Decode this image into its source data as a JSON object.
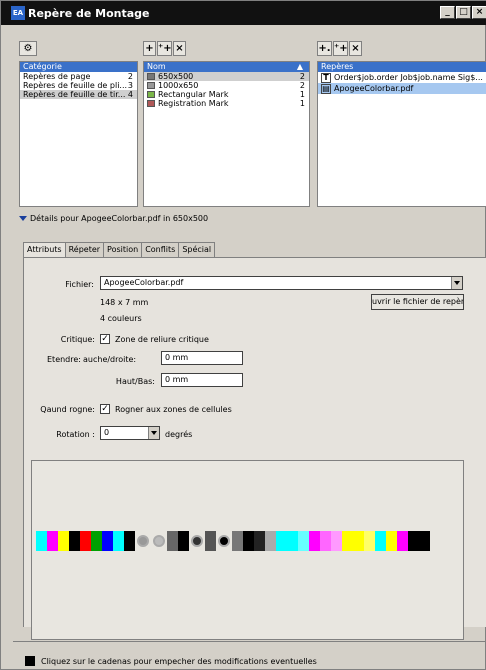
{
  "window": {
    "title": "Repère de Montage",
    "app_icon": "EA"
  },
  "categories": {
    "header": "Catégorie",
    "items": [
      {
        "label": "Repères de page",
        "count": "2"
      },
      {
        "label": "Repères de feuille de pli...",
        "count": "3"
      },
      {
        "label": "Repères de feuille de tir...",
        "count": "4"
      }
    ]
  },
  "names": {
    "header": "Nom",
    "items": [
      {
        "label": "650x500",
        "count": "2",
        "swatch": "#777777"
      },
      {
        "label": "1000x650",
        "count": "2",
        "swatch": "#999999"
      },
      {
        "label": "Rectangular Mark",
        "count": "1",
        "swatch": "#7ab648"
      },
      {
        "label": "Registration Mark",
        "count": "1",
        "swatch": "#b05858"
      }
    ]
  },
  "marks": {
    "header": "Repères",
    "items": [
      {
        "label": "Order$job.order Job$job.name Sig$...",
        "icon": "text-icon"
      },
      {
        "label": "ApogeeColorbar.pdf",
        "icon": "pdf-icon"
      }
    ]
  },
  "details_label": "Détails pour ApogeeColorbar.pdf in 650x500",
  "tabs": [
    "Attributs",
    "Répeter",
    "Position",
    "Conflits",
    "Spécial"
  ],
  "form": {
    "fichier_label": "Fichier:",
    "fichier_value": "ApogeeColorbar.pdf",
    "size": "148 x 7 mm",
    "colors": "4 couleurs",
    "open_button": "uvrir le fichier de repère",
    "critique_label": "Critique:",
    "critique_check": "Zone de reliure critique",
    "etendre_label": "Etendre:",
    "gauche_label": "auche/droite:",
    "gauche_value": "0 mm",
    "haut_label": "Haut/Bas:",
    "haut_value": "0 mm",
    "rogne_label": "Qaund rogne:",
    "rogne_check": "Rogner aux zones de cellules",
    "rotation_label": "Rotation :",
    "rotation_value": "0",
    "rotation_unit": "degrés"
  },
  "footer": "Cliquez sur le cadenas pour empecher des modifications eventuelles",
  "colorbar": [
    "#00ffff",
    "#ff00ff",
    "#ffff00",
    "#000000",
    "#ff0000",
    "#00a000",
    "#0000ff",
    "#00ffff",
    "#000000",
    "#999999",
    "#bbbbbb",
    "#666666",
    "#000000",
    "#333333",
    "#555555",
    "#000000",
    "#777777",
    "#000000",
    "#222222",
    "#aaaaaa",
    "#00ffff",
    "#00ffff",
    "#66ffff",
    "#ff00ff",
    "#ff66ff",
    "#ff99ff",
    "#ffff00",
    "#ffff00",
    "#ffff66",
    "#00ffff",
    "#ffff00",
    "#ff00ff",
    "#000000",
    "#000000"
  ]
}
